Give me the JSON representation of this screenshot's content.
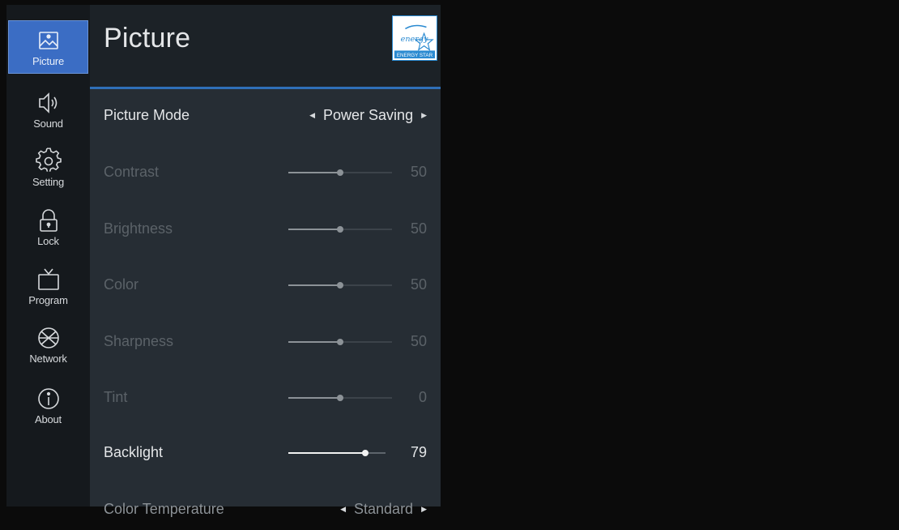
{
  "sidebar": {
    "items": [
      {
        "label": "Picture",
        "icon": "picture-icon",
        "active": true
      },
      {
        "label": "Sound",
        "icon": "speaker-icon"
      },
      {
        "label": "Setting",
        "icon": "gear-icon"
      },
      {
        "label": "Lock",
        "icon": "lock-icon"
      },
      {
        "label": "Program",
        "icon": "tv-icon"
      },
      {
        "label": "Network",
        "icon": "globe-icon"
      },
      {
        "label": "About",
        "icon": "info-icon"
      }
    ]
  },
  "header": {
    "title": "Picture",
    "badge": "ENERGY STAR",
    "badge_script": "energy"
  },
  "colors": {
    "accent": "#3b6dc4",
    "divider": "#2f6fb8",
    "energy_star": "#2a8ad1"
  },
  "settings": {
    "picture_mode": {
      "label": "Picture Mode",
      "value": "Power Saving"
    },
    "contrast": {
      "label": "Contrast",
      "value": "50",
      "level": 0.5
    },
    "brightness": {
      "label": "Brightness",
      "value": "50",
      "level": 0.5
    },
    "color": {
      "label": "Color",
      "value": "50",
      "level": 0.5
    },
    "sharpness": {
      "label": "Sharpness",
      "value": "50",
      "level": 0.5
    },
    "tint": {
      "label": "Tint",
      "value": "0",
      "level": 0.5
    },
    "backlight": {
      "label": "Backlight",
      "value": "79",
      "level": 0.79
    },
    "color_temperature": {
      "label": "Color Temperature",
      "value": "Standard"
    }
  }
}
